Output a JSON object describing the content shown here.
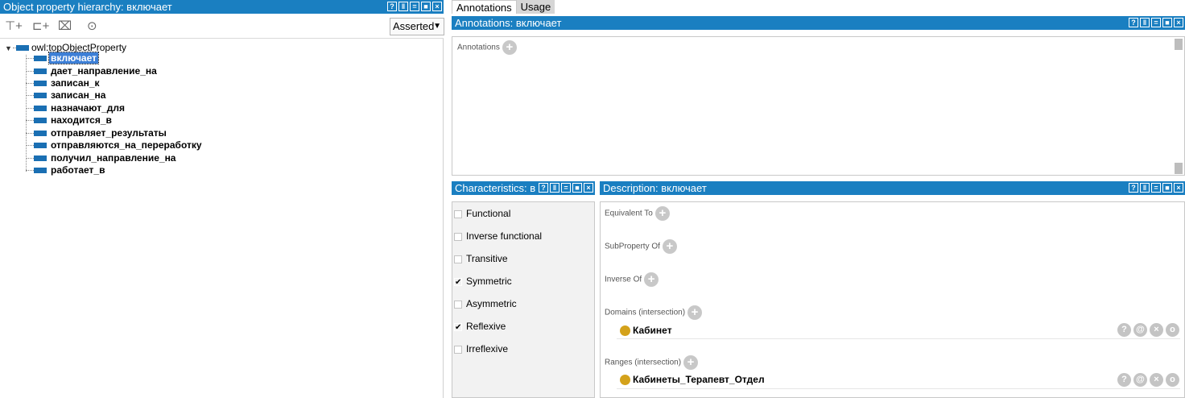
{
  "left_panel": {
    "title": "Object property hierarchy: включает",
    "view_mode": "Asserted",
    "root": "owl:topObjectProperty",
    "items": [
      {
        "label": "включает",
        "selected": true
      },
      {
        "label": "дает_направление_на"
      },
      {
        "label": "записан_к"
      },
      {
        "label": "записан_на"
      },
      {
        "label": "назначают_для"
      },
      {
        "label": "находится_в"
      },
      {
        "label": "отправляет_результаты"
      },
      {
        "label": "отправляются_на_переработку"
      },
      {
        "label": "получил_направление_на"
      },
      {
        "label": "работает_в"
      }
    ]
  },
  "tabs": [
    "Annotations",
    "Usage"
  ],
  "annotations": {
    "title": "Annotations: включает",
    "section_label": "Annotations"
  },
  "characteristics": {
    "title": "Characteristics: в",
    "items": [
      {
        "label": "Functional",
        "checked": false
      },
      {
        "label": "Inverse functional",
        "checked": false
      },
      {
        "label": "Transitive",
        "checked": false
      },
      {
        "label": "Symmetric",
        "checked": true
      },
      {
        "label": "Asymmetric",
        "checked": false
      },
      {
        "label": "Reflexive",
        "checked": true
      },
      {
        "label": "Irreflexive",
        "checked": false
      }
    ]
  },
  "description": {
    "title": "Description: включает",
    "equivalent_to": "Equivalent To",
    "subproperty_of": "SubProperty Of",
    "inverse_of": "Inverse Of",
    "domains": "Domains (intersection)",
    "domain_value": "Кабинет",
    "ranges": "Ranges (intersection)",
    "range_value": "Кабинеты_Терапевт_Отдел"
  },
  "colors": {
    "title_bar": "#1a7fc1",
    "property_icon": "#1a6fb3",
    "class_icon": "#d4a21b",
    "selection": "#3d7fd6"
  }
}
